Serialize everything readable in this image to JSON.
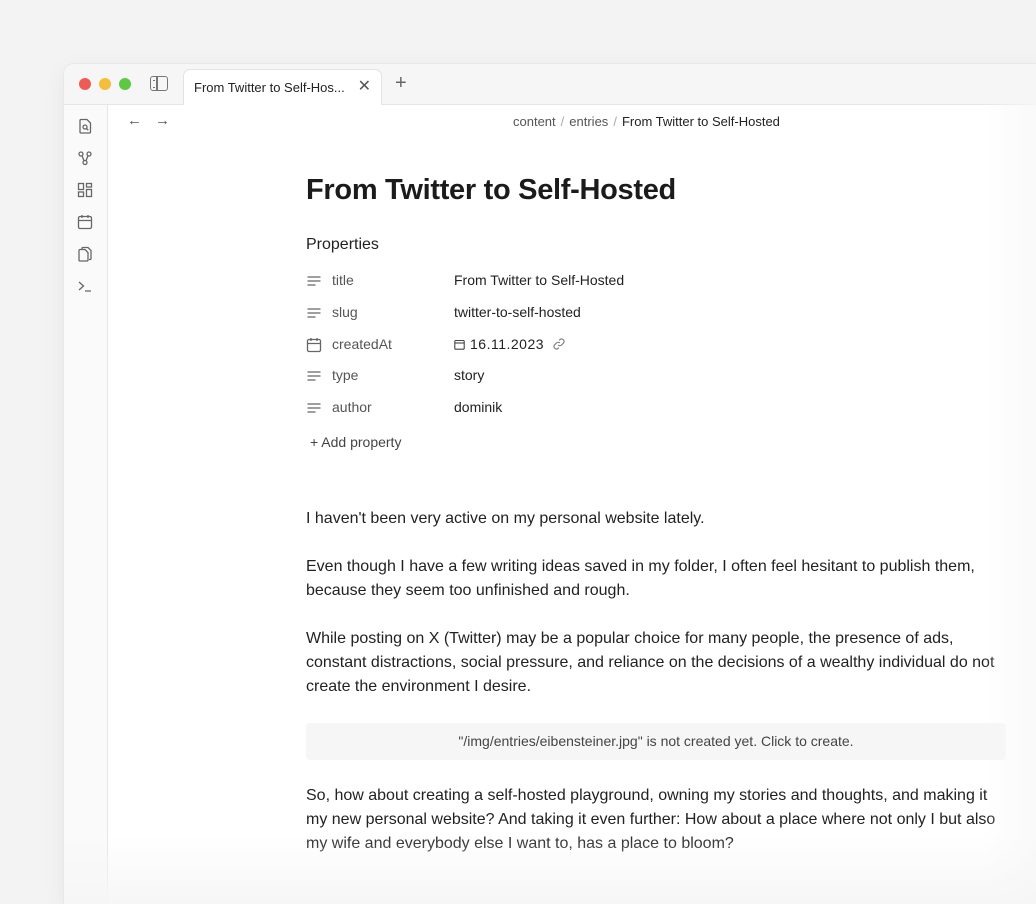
{
  "tab": {
    "title": "From Twitter to Self-Hos...",
    "close": "✕",
    "new": "+"
  },
  "ribbon": {
    "icons": [
      "open-quick-switcher-icon",
      "graph-view-icon",
      "canvas-icon",
      "daily-note-icon",
      "templates-icon",
      "terminal-icon"
    ]
  },
  "nav": {
    "back": "←",
    "forward": "→"
  },
  "breadcrumb": {
    "parts": [
      "content",
      "entries",
      "From Twitter to Self-Hosted"
    ],
    "separator": "/"
  },
  "document": {
    "title": "From Twitter to Self-Hosted",
    "properties_heading": "Properties",
    "properties": [
      {
        "key": "title",
        "value": "From Twitter to Self-Hosted",
        "icon": "text-lines-icon"
      },
      {
        "key": "slug",
        "value": "twitter-to-self-hosted",
        "icon": "text-lines-icon"
      },
      {
        "key": "createdAt",
        "value": "16.11.2023",
        "icon": "calendar-icon"
      },
      {
        "key": "type",
        "value": "story",
        "icon": "text-lines-icon"
      },
      {
        "key": "author",
        "value": "dominik",
        "icon": "text-lines-icon"
      }
    ],
    "add_property": "+ Add property",
    "paragraphs": [
      "I haven't been very active on my personal website lately.",
      "Even though I have a few writing ideas saved in my folder, I often feel hesitant to publish them, because they seem too unfinished and rough.",
      "While posting on X (Twitter) may be a popular choice for many people, the presence of ads, constant distractions, social pressure, and reliance on the decisions of a wealthy individual do not create the environment I desire.",
      "So, how about creating a self-hosted playground, owning my stories and thoughts, and making it my new personal website? And taking it even further: How about a place where not only I but also my wife and everybody else I want to, has a place to bloom?"
    ],
    "image_placeholder": "\"/img/entries/eibensteiner.jpg\" is not created yet. Click to create."
  },
  "colors": {
    "close": "#ee5b55",
    "minimize": "#f4bd3b",
    "maximize": "#5dc842",
    "accent": "#222222"
  }
}
